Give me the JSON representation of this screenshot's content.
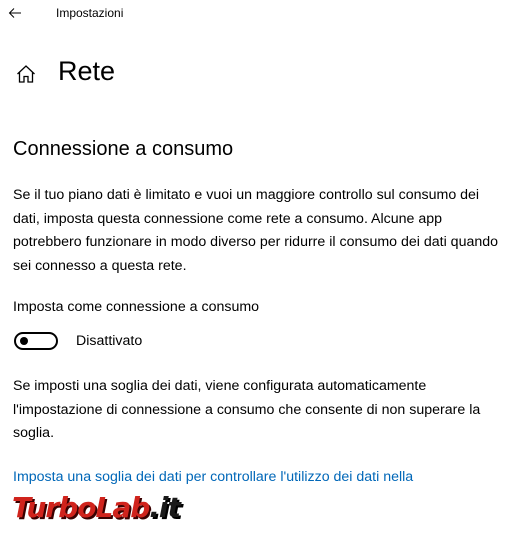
{
  "titlebar": {
    "back_icon": "back-arrow-icon",
    "title": "Impostazioni"
  },
  "header": {
    "home_icon": "home-icon",
    "page_title": "Rete"
  },
  "section": {
    "title": "Connessione a consumo",
    "description_1": "Se il tuo piano dati è limitato e vuoi un maggiore controllo sul consumo dei dati, imposta questa connessione come rete a consumo. Alcune app potrebbero funzionare in modo diverso per ridurre il consumo dei dati quando sei connesso a questa rete.",
    "toggle_label": "Imposta come connessione a consumo",
    "toggle_state": "Disattivato",
    "toggle_on": false,
    "description_2": "Se imposti una soglia dei dati, viene configurata automaticamente l'impostazione di connessione a consumo che consente di non superare la soglia.",
    "link": "Imposta una soglia dei dati per controllare l'utilizzo dei dati nella"
  },
  "watermark": {
    "part_1": "TurboLab",
    "part_2": ".it"
  },
  "colors": {
    "link": "#0067b8",
    "watermark_red": "#d0231c",
    "text": "#000000",
    "background": "#ffffff"
  }
}
